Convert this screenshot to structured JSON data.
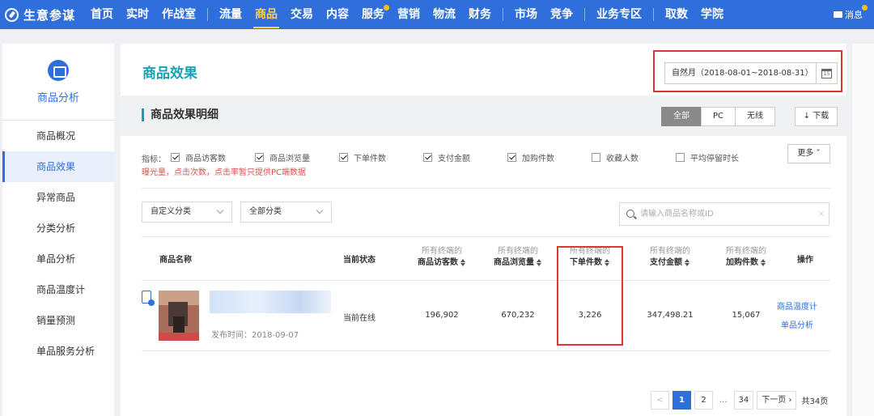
{
  "app": {
    "name": "生意参谋",
    "icon": "compass-icon"
  },
  "nav": {
    "items": [
      {
        "label": "首页"
      },
      {
        "label": "实时"
      },
      {
        "label": "作战室"
      },
      {
        "label": "流量"
      },
      {
        "label": "商品",
        "active": true
      },
      {
        "label": "交易"
      },
      {
        "label": "内容"
      },
      {
        "label": "服务",
        "badge": true
      },
      {
        "label": "营销"
      },
      {
        "label": "物流"
      },
      {
        "label": "财务"
      },
      {
        "label": "市场"
      },
      {
        "label": "竞争"
      },
      {
        "label": "业务专区"
      },
      {
        "label": "取数"
      },
      {
        "label": "学院"
      }
    ],
    "message_label": "消息"
  },
  "sidebar": {
    "title": "商品分析",
    "icon": "product-analysis-icon",
    "items": [
      {
        "label": "商品概况"
      },
      {
        "label": "商品效果",
        "active": true
      },
      {
        "label": "异常商品"
      },
      {
        "label": "分类分析"
      },
      {
        "label": "单品分析"
      },
      {
        "label": "商品温度计"
      },
      {
        "label": "销量预测"
      },
      {
        "label": "单品服务分析"
      }
    ]
  },
  "main": {
    "title": "商品效果",
    "date_range": "自然月（2018-08-01~2018-08-31）",
    "calendar_icon_text": "15",
    "section_title": "商品效果明细",
    "segments": [
      "全部",
      "PC",
      "无线"
    ],
    "active_segment": "全部",
    "download_label": "下载",
    "indicator_label": "指标：",
    "indicators": [
      {
        "label": "商品访客数",
        "checked": true
      },
      {
        "label": "商品浏览量",
        "checked": true
      },
      {
        "label": "下单件数",
        "checked": true
      },
      {
        "label": "支付金额",
        "checked": true
      },
      {
        "label": "加购件数",
        "checked": true
      },
      {
        "label": "收藏人数",
        "checked": false
      },
      {
        "label": "平均停留时长",
        "checked": false
      }
    ],
    "more_label": "更多",
    "hint": "曝光量，点击次数，点击率暂只提供PC端数据",
    "filter_custom": "自定义分类",
    "filter_all": "全部分类",
    "search_placeholder": "请输入商品名称或ID",
    "columns": {
      "name": "商品名称",
      "status": "当前状态",
      "visitors": {
        "top": "所有终端的",
        "bottom": "商品访客数"
      },
      "pageviews": {
        "top": "所有终端的",
        "bottom": "商品浏览量"
      },
      "orders": {
        "top": "所有终端的",
        "bottom": "下单件数"
      },
      "payment": {
        "top": "所有终端的",
        "bottom": "支付金额"
      },
      "cart": {
        "top": "所有终端的",
        "bottom": "加购件数"
      },
      "ops": "操作"
    },
    "row": {
      "publish": "发布时间：2018-09-07",
      "status": "当前在线",
      "visitors": "196,902",
      "pageviews": "670,232",
      "orders": "3,226",
      "payment": "347,498.21",
      "cart": "15,067",
      "op1": "商品温度计",
      "op2": "单品分析"
    },
    "pagination": {
      "prev": "<",
      "pages": [
        "1",
        "2"
      ],
      "current": "1",
      "dots": "...",
      "last": "34",
      "next": "下一页",
      "total": "共34页"
    }
  },
  "colors": {
    "brand": "#2f6fdc",
    "accent_title": "#18a0b5",
    "highlight": "#e03535",
    "active_nav": "#ffd24a"
  }
}
